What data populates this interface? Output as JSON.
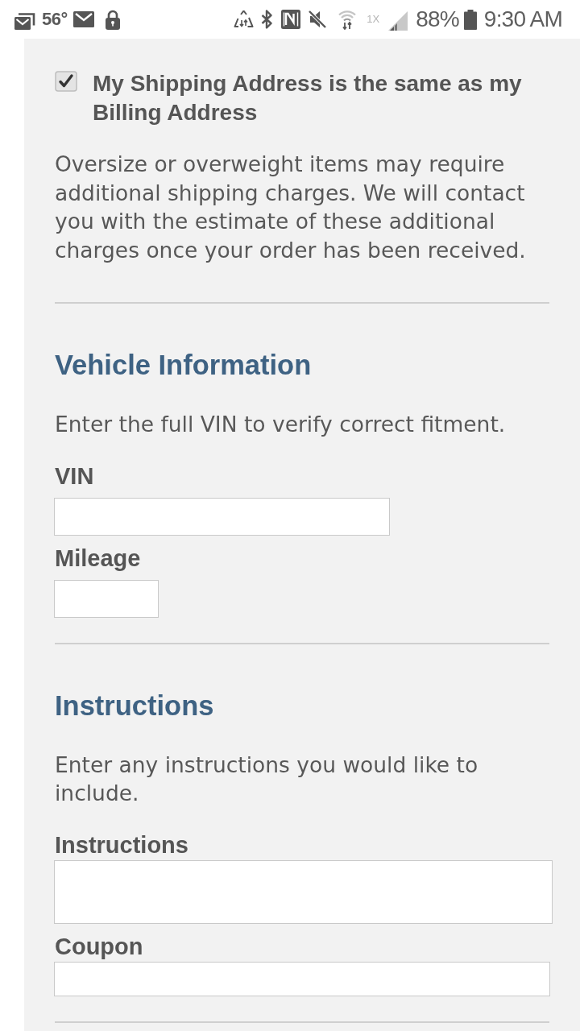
{
  "status_bar": {
    "temperature": "56°",
    "network_type": "1X",
    "battery": "88%",
    "time": "9:30 AM"
  },
  "shipping": {
    "same_as_billing": {
      "label": "My Shipping Address is the same as my Billing Address",
      "checked": true
    },
    "note": "Oversize or overweight items may require additional shipping charges. We will contact you with the estimate of these additional charges once your order has been received."
  },
  "sections": [
    {
      "title": "Vehicle Information",
      "description": "Enter the full VIN to verify correct fitment.",
      "fields": [
        {
          "label": "VIN",
          "kind": "medium"
        },
        {
          "label": "Mileage",
          "kind": "short"
        }
      ]
    },
    {
      "title": "Instructions",
      "description": "Enter any instructions you would like to include.",
      "fields": [
        {
          "label": "Instructions",
          "kind": "textarea"
        },
        {
          "label": "Coupon",
          "kind": "full"
        }
      ]
    }
  ]
}
